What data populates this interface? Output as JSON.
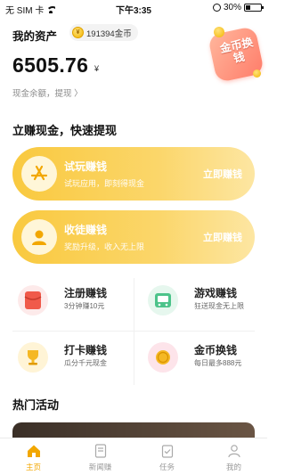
{
  "status_bar": {
    "carrier": "无 SIM 卡",
    "time": "下午3:35",
    "battery_percent": "30%",
    "battery_level": 0.3
  },
  "assets": {
    "title": "我的资产",
    "coins": "191394金币",
    "balance": "6505.76",
    "balance_unit": "¥",
    "cash_link": "现金余额，提现 〉",
    "exchange_badge": "金币换钱"
  },
  "section_earn": {
    "title": "立赚现金，快速提现"
  },
  "big_cards": [
    {
      "title": "试玩赚钱",
      "subtitle": "试玩应用，即刻得现金",
      "cta": "立即赚钱",
      "icon": "app-store-icon"
    },
    {
      "title": "收徒赚钱",
      "subtitle": "奖励升级，收入无上限",
      "cta": "立即赚钱",
      "icon": "user-icon"
    }
  ],
  "grid": [
    {
      "title": "注册赚钱",
      "subtitle": "3分钟赚10元",
      "icon": "red-envelope-icon",
      "color": "#f05a4a"
    },
    {
      "title": "游戏赚钱",
      "subtitle": "狂送现金无上限",
      "icon": "game-controller-icon",
      "color": "#4cc38a"
    },
    {
      "title": "打卡赚钱",
      "subtitle": "瓜分千元现金",
      "icon": "trophy-icon",
      "color": "#f5b824"
    },
    {
      "title": "金币换钱",
      "subtitle": "每日最多888元",
      "icon": "coin-exchange-icon",
      "color": "#f26b86"
    }
  ],
  "section_hot": {
    "title": "热门活动"
  },
  "tab_bar": [
    {
      "label": "主页",
      "icon": "home-icon",
      "active": true
    },
    {
      "label": "新闻赚",
      "icon": "news-icon",
      "active": false
    },
    {
      "label": "任务",
      "icon": "task-icon",
      "active": false
    },
    {
      "label": "我的",
      "icon": "profile-icon",
      "active": false
    }
  ],
  "colors": {
    "accent": "#f2a700",
    "card_gradient_start": "#f9c93f",
    "card_gradient_end": "#fde6a2"
  }
}
